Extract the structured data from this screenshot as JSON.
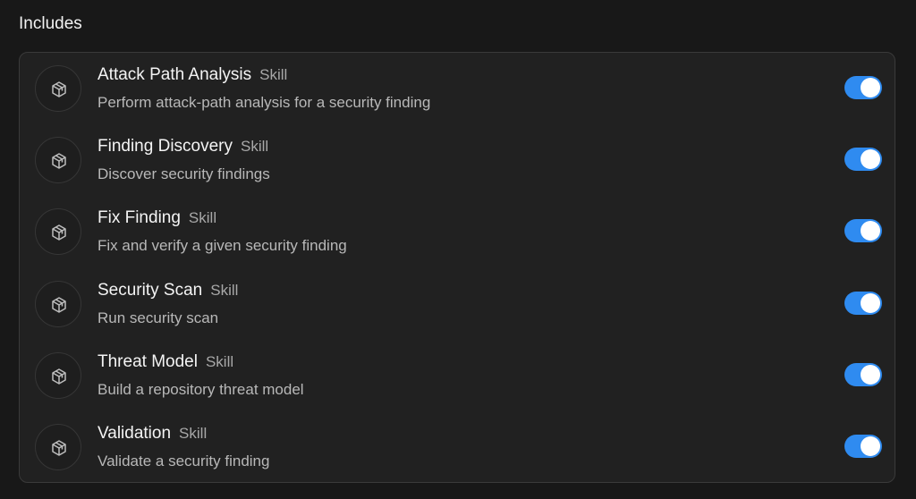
{
  "section": {
    "title": "Includes"
  },
  "items": [
    {
      "name": "Attack Path Analysis",
      "tag": "Skill",
      "description": "Perform attack-path analysis for a security finding",
      "icon": "cube-icon",
      "enabled": true
    },
    {
      "name": "Finding Discovery",
      "tag": "Skill",
      "description": "Discover security findings",
      "icon": "cube-icon",
      "enabled": true
    },
    {
      "name": "Fix Finding",
      "tag": "Skill",
      "description": "Fix and verify a given security finding",
      "icon": "cube-icon",
      "enabled": true
    },
    {
      "name": "Security Scan",
      "tag": "Skill",
      "description": "Run security scan",
      "icon": "cube-icon",
      "enabled": true
    },
    {
      "name": "Threat Model",
      "tag": "Skill",
      "description": "Build a repository threat model",
      "icon": "cube-icon",
      "enabled": true
    },
    {
      "name": "Validation",
      "tag": "Skill",
      "description": "Validate a security finding",
      "icon": "cube-icon",
      "enabled": true
    }
  ],
  "colors": {
    "background": "#181818",
    "card": "#212121",
    "toggle_on": "#2f8bf0"
  }
}
